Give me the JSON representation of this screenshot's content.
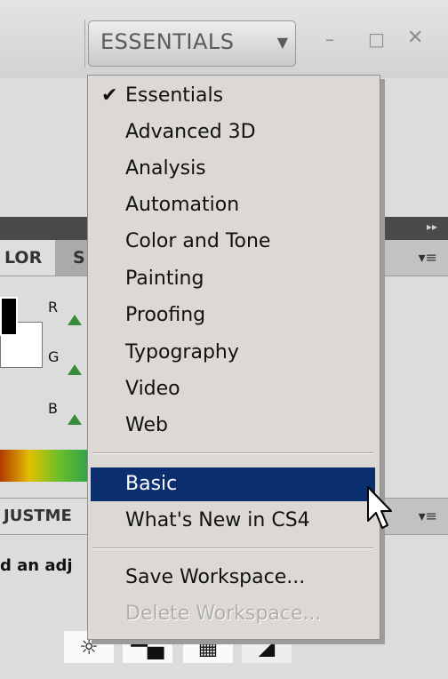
{
  "topbar": {
    "workspace_label": "ESSENTIALS",
    "dropdown_arrow": "▼",
    "minimize": "–",
    "maximize": "□",
    "close": "✕"
  },
  "panels": {
    "color_tab_label": "LOR",
    "next_tab_label": "S",
    "channels": [
      "R",
      "G",
      "B"
    ],
    "adjustments_tab_label": "JUSTME",
    "adjustments_text": "d an adj",
    "panel_menu_icon": "▾≡",
    "collapse_icon": "▸▸"
  },
  "menu": {
    "check_glyph": "✔",
    "workspaces": [
      {
        "label": "Essentials",
        "checked": true
      },
      {
        "label": "Advanced 3D"
      },
      {
        "label": "Analysis"
      },
      {
        "label": "Automation"
      },
      {
        "label": "Color and Tone"
      },
      {
        "label": "Painting"
      },
      {
        "label": "Proofing"
      },
      {
        "label": "Typography"
      },
      {
        "label": "Video"
      },
      {
        "label": "Web"
      }
    ],
    "custom": [
      {
        "label": "Basic",
        "highlighted": true
      },
      {
        "label": "What's New in CS4"
      }
    ],
    "actions": [
      {
        "label": "Save Workspace..."
      },
      {
        "label": "Delete Workspace...",
        "disabled": true
      }
    ]
  },
  "colors": {
    "menu_bg": "#dcd8d3",
    "highlight": "#0b2e6f",
    "panel_dark": "#4a4a4a"
  }
}
